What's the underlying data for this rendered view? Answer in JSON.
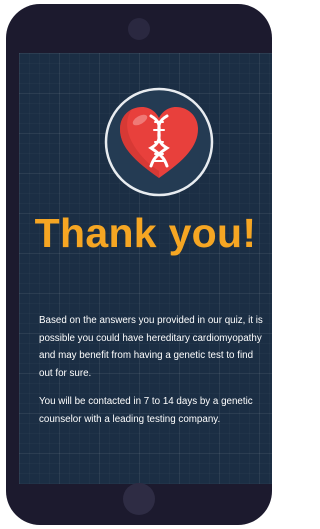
{
  "screen": {
    "title": "Thank you!",
    "paragraph1": "Based on the answers you provided in our quiz, it is possible you could have hereditary cardiomyopathy and may benefit from having a genetic test to find out for sure.",
    "paragraph2": "You will be contacted in 7 to 14 days by a genetic counselor with a leading testing company."
  },
  "colors": {
    "title": "#f6a623",
    "heart": "#e8403c",
    "background": "#1b2e44",
    "badge": "#233a52"
  },
  "icons": {
    "badge": "heart-dna-icon"
  }
}
